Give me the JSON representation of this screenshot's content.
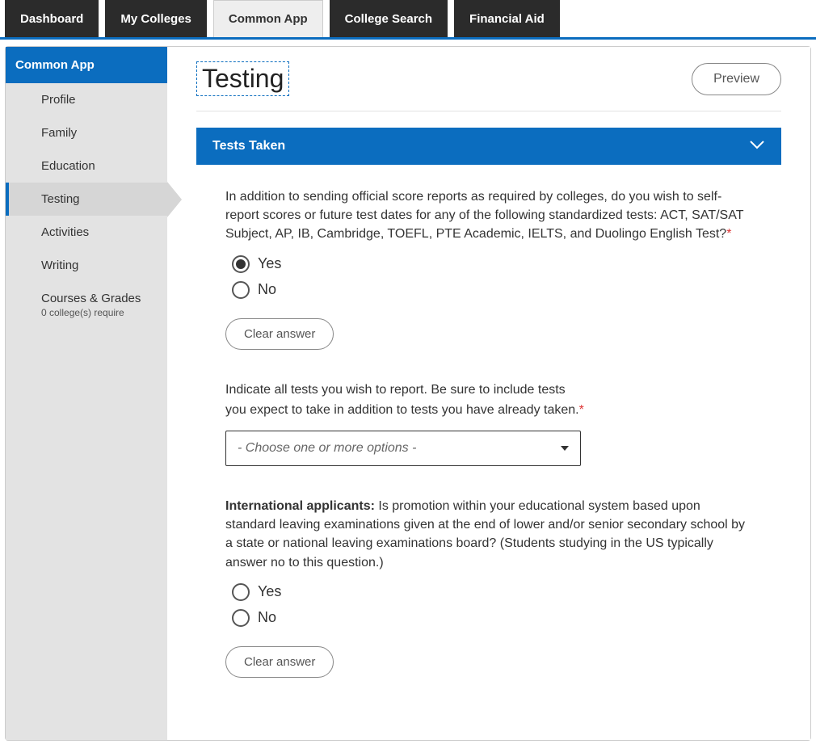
{
  "tabs": [
    {
      "label": "Dashboard",
      "active": false
    },
    {
      "label": "My Colleges",
      "active": false
    },
    {
      "label": "Common App",
      "active": true
    },
    {
      "label": "College Search",
      "active": false
    },
    {
      "label": "Financial Aid",
      "active": false
    }
  ],
  "sidebar": {
    "header": "Common App",
    "items": [
      {
        "label": "Profile",
        "active": false
      },
      {
        "label": "Family",
        "active": false
      },
      {
        "label": "Education",
        "active": false
      },
      {
        "label": "Testing",
        "active": true
      },
      {
        "label": "Activities",
        "active": false
      },
      {
        "label": "Writing",
        "active": false
      },
      {
        "label": "Courses & Grades",
        "sub": "0 college(s) require",
        "active": false
      }
    ]
  },
  "page": {
    "title": "Testing",
    "preview": "Preview"
  },
  "section": {
    "title": "Tests Taken"
  },
  "q1": {
    "text": "In addition to sending official score reports as required by colleges, do you wish to self-report scores or future test dates for any of the following standardized tests: ACT, SAT/SAT Subject, AP, IB, Cambridge, TOEFL, PTE Academic, IELTS, and Duolingo English Test?",
    "yes": "Yes",
    "no": "No",
    "selected": "yes",
    "clear": "Clear answer"
  },
  "q2": {
    "line1": "Indicate all tests you wish to report. Be sure to include tests",
    "line2": "you expect to take in addition to tests you have already taken.",
    "placeholder": "- Choose one or more options -"
  },
  "q3": {
    "bold": "International applicants:",
    "text": " Is promotion within your educational system based upon standard leaving examinations given at the end of lower and/or senior secondary school by a state or national leaving examinations board? (Students studying in the US typically answer no to this question.)",
    "yes": "Yes",
    "no": "No",
    "selected": null,
    "clear": "Clear answer"
  }
}
